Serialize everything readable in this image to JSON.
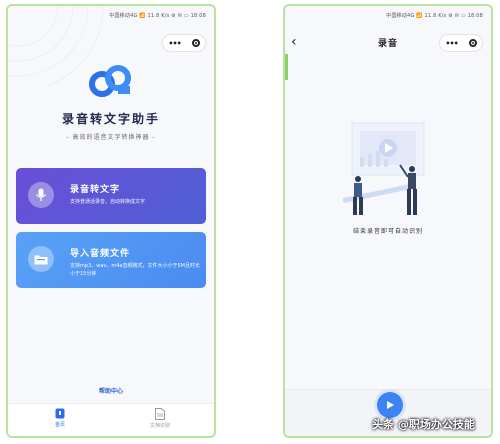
{
  "left": {
    "status": "中国移动4G 📶 11.8 K/s  ⚙ ✉ ▭ 18:08",
    "capsule": {
      "dots": "•••",
      "target": ""
    },
    "app_title": "录音转文字助手",
    "app_subtitle": "- 高效的语音文字转换神器 -",
    "cards": [
      {
        "title": "录音转文字",
        "desc": "支持普通话录音，自动转换成文字"
      },
      {
        "title": "导入音频文件",
        "desc": "支持mp3、wav、m4a音频格式，文件大小小于5M且时长小于15分钟"
      }
    ],
    "help": "帮助中心",
    "tabs": [
      {
        "label": "首页"
      },
      {
        "label": "文档识别"
      }
    ]
  },
  "right": {
    "status": "中国移动4G 📶 11.8 K/s  ⚙ ✉ ▭ 18:08",
    "back": "‹",
    "title": "录音",
    "hint": "结束录音即可自动识别"
  },
  "watermark": "头条 @职场办公技能",
  "colors": {
    "accent": "#3d83f3",
    "card1": "#5a56d8",
    "card2": "#55a0f6",
    "frame": "#b7e39f"
  }
}
